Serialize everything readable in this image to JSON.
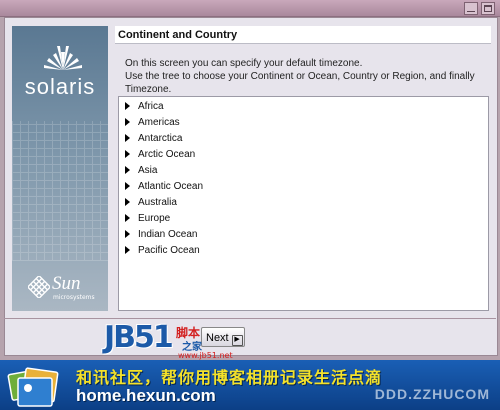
{
  "window": {
    "controls": [
      "minimize",
      "maximize"
    ]
  },
  "sidebar": {
    "product_logo": "solaris",
    "vendor_logo": "Sun",
    "vendor_sub": "microsystems"
  },
  "panel": {
    "title": "Continent and Country",
    "description": [
      "On this screen you can specify your default timezone.",
      "Use the tree to choose your Continent or Ocean, Country or Region, and finally",
      "Timezone."
    ]
  },
  "tree": {
    "items": [
      "Africa",
      "Americas",
      "Antarctica",
      "Arctic Ocean",
      "Asia",
      "Atlantic Ocean",
      "Australia",
      "Europe",
      "Indian Ocean",
      "Pacific Ocean"
    ]
  },
  "buttons": {
    "next_label": "Next",
    "next_icon": "chevron-right-icon"
  },
  "watermark": {
    "site_logo": "JB51",
    "site_cn": "脚本",
    "site_cn2": "之家",
    "site_url": "www.jb51.net",
    "banner_title": "和讯社区，帮你用博客相册记录生活点滴",
    "banner_url": "home.hexun.com",
    "banner_url_right": "DDD.ZZHUCOM"
  },
  "colors": {
    "title_yellow": "#f4e22a",
    "banner_blue": "#1a5fb5",
    "sidebar_blue": "#5a7892"
  }
}
